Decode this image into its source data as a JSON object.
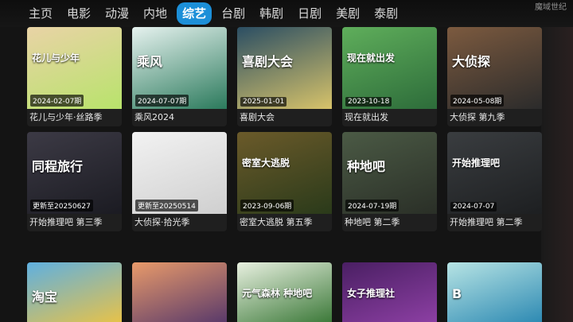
{
  "nav": {
    "items": [
      "主页",
      "电影",
      "动漫",
      "内地",
      "综艺",
      "台剧",
      "韩剧",
      "日剧",
      "美剧",
      "泰剧"
    ],
    "active_index": 4
  },
  "corner_logo": "魔域世纪",
  "cards": [
    {
      "title": "花儿与少年·丝路季",
      "date": "2024-02-07期",
      "colors": [
        "#e9d3a6",
        "#b8e36b"
      ]
    },
    {
      "title": "乘风2024",
      "date": "2024-07-07期",
      "colors": [
        "#e6f2ef",
        "#2b7a5c"
      ]
    },
    {
      "title": "喜剧大会",
      "date": "2025-01-01",
      "colors": [
        "#2b4e63",
        "#d7c36a"
      ]
    },
    {
      "title": "现在就出发",
      "date": "2023-10-18",
      "colors": [
        "#5fae5b",
        "#2d6c3a"
      ]
    },
    {
      "title": "大侦探 第九季",
      "date": "2024-05-08期",
      "colors": [
        "#7c5a3f",
        "#2b2b2b"
      ]
    },
    {
      "title": "开始推理吧 第三季",
      "date": "更新至20250627",
      "colors": [
        "#3c3a45",
        "#1b1b22"
      ]
    },
    {
      "title": "大侦探·拾光季",
      "date": "更新至20250514",
      "colors": [
        "#f2f2f2",
        "#cfcfcf"
      ]
    },
    {
      "title": "密室大逃脱 第五季",
      "date": "2023-09-06期",
      "colors": [
        "#6b5a2a",
        "#2a3a1a"
      ]
    },
    {
      "title": "种地吧 第二季",
      "date": "2024-07-19期",
      "colors": [
        "#4b5a45",
        "#2a2f27"
      ]
    },
    {
      "title": "开始推理吧 第二季",
      "date": "2024-07-07",
      "colors": [
        "#3a3d40",
        "#1d1f21"
      ]
    },
    {
      "title": "",
      "date": "",
      "colors": [
        "#5fb0e0",
        "#e6c24a"
      ]
    },
    {
      "title": "",
      "date": "",
      "colors": [
        "#e89a6a",
        "#5a3a6a"
      ]
    },
    {
      "title": "",
      "date": "",
      "colors": [
        "#e8f0e0",
        "#3d7a3a"
      ]
    },
    {
      "title": "",
      "date": "",
      "colors": [
        "#4a1f63",
        "#8c3fa3"
      ]
    },
    {
      "title": "",
      "date": "",
      "colors": [
        "#b7e4e4",
        "#2e8ab3"
      ]
    }
  ],
  "poster_texts": [
    "花儿与少年",
    "乘风",
    "喜剧大会",
    "现在就出发",
    "大侦探",
    "同程旅行",
    "",
    "密室大逃脱",
    "种地吧",
    "开始推理吧",
    "淘宝",
    "",
    "元气森林 种地吧",
    "女子推理社",
    "B"
  ]
}
